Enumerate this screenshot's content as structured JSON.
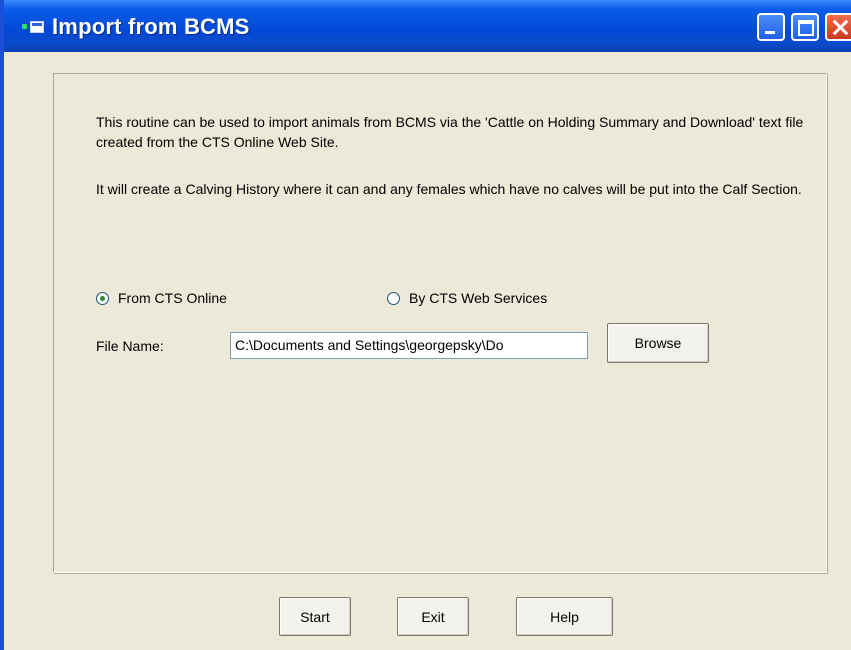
{
  "window": {
    "title": "Import from BCMS"
  },
  "description": {
    "paragraph1": "This routine can be used to import animals from BCMS via the 'Cattle on Holding Summary and Download' text file created from the CTS Online Web Site.",
    "paragraph2": "It will create a Calving History where it can and any females which have no calves will be put into the Calf Section."
  },
  "source": {
    "option_online": "From CTS Online",
    "option_webservices": "By CTS Web Services",
    "selected": "From CTS Online"
  },
  "file": {
    "label": "File Name:",
    "value": "C:\\Documents and Settings\\georgepsky\\Do",
    "browse_label": "Browse"
  },
  "buttons": {
    "start": "Start",
    "exit": "Exit",
    "help": "Help"
  }
}
